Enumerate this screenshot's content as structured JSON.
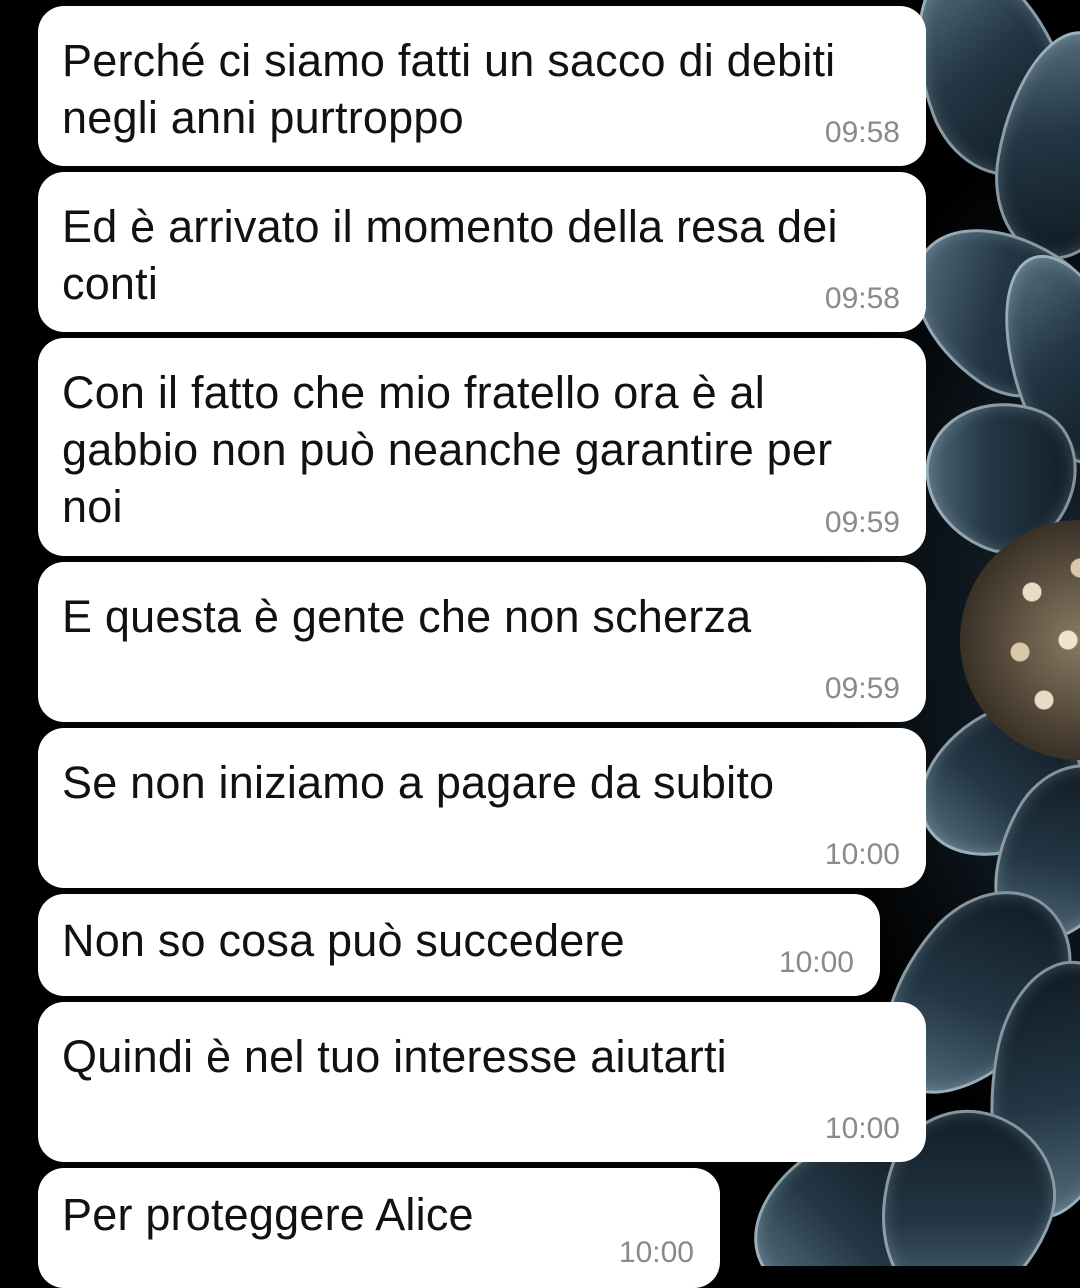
{
  "chat": {
    "messages": [
      {
        "text": "Perché ci siamo fatti un sacco di debiti negli anni purtroppo",
        "time": "09:58"
      },
      {
        "text": "Ed è arrivato il momento della resa dei conti",
        "time": "09:58"
      },
      {
        "text": "Con il fatto che mio fratello ora è al gabbio non può neanche garantire per noi",
        "time": "09:59"
      },
      {
        "text": "E questa è gente che non scherza",
        "time": "09:59"
      },
      {
        "text": "Se non iniziamo a pagare da subito",
        "time": "10:00"
      },
      {
        "text": "Non so cosa può succedere",
        "time": "10:00"
      },
      {
        "text": "Quindi è nel tuo interesse aiutarti",
        "time": "10:00"
      },
      {
        "text": "Per proteggere Alice",
        "time": "10:00"
      }
    ]
  },
  "colors": {
    "bubble_background": "#ffffff",
    "message_text": "#111111",
    "timestamp_text": "#8a8a8a",
    "wallpaper_background": "#000000"
  },
  "wallpaper": {
    "subject": "dark dahlia flower"
  }
}
